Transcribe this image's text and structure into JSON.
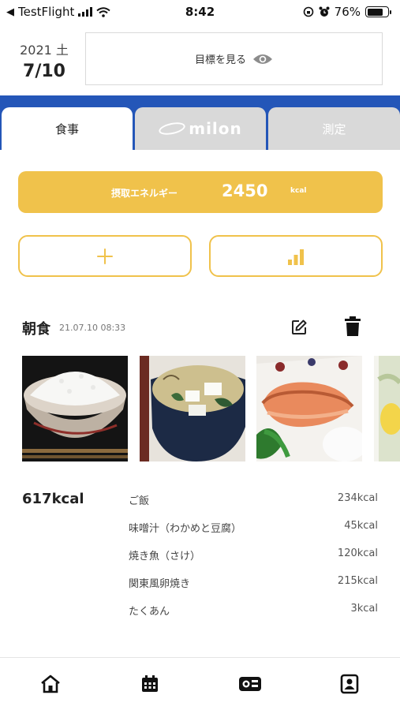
{
  "status_bar": {
    "back_label": "TestFlight",
    "time": "8:42",
    "battery": "76%",
    "battery_level": 0.76
  },
  "header": {
    "year_day": "2021 土",
    "date": "7/10",
    "goal_button_label": "目標を見る"
  },
  "tabs": [
    {
      "label": "食事",
      "active": true
    },
    {
      "label": "milon",
      "active": false
    },
    {
      "label": "測定",
      "active": false
    }
  ],
  "energy": {
    "label": "摂取エネルギー",
    "value": "2450",
    "unit": "kcal"
  },
  "meal": {
    "title": "朝食",
    "timestamp": "21.07.10 08:33",
    "total": "617kcal",
    "photos": [
      "rice-bowl-photo",
      "miso-soup-photo",
      "grilled-salmon-photo",
      "partial-dish-photo"
    ],
    "items": [
      {
        "name": "ご飯",
        "kcal": "234kcal"
      },
      {
        "name": "味噌汁（わかめと豆腐）",
        "kcal": "45kcal"
      },
      {
        "name": "焼き魚（さけ）",
        "kcal": "120kcal"
      },
      {
        "name": "関東風卵焼き",
        "kcal": "215kcal"
      },
      {
        "name": "たくあん",
        "kcal": "3kcal"
      }
    ]
  },
  "icons": {
    "goal": "eye-icon",
    "add": "plus-icon",
    "stats": "bar-chart-icon",
    "edit": "edit-icon",
    "delete": "trash-icon",
    "nav": [
      "home-icon",
      "calendar-icon",
      "meal-icon",
      "profile-icon"
    ]
  },
  "colors": {
    "accent": "#f0c24b",
    "brand_blue": "#2456b8",
    "inactive_tab": "#d9d9d9"
  }
}
